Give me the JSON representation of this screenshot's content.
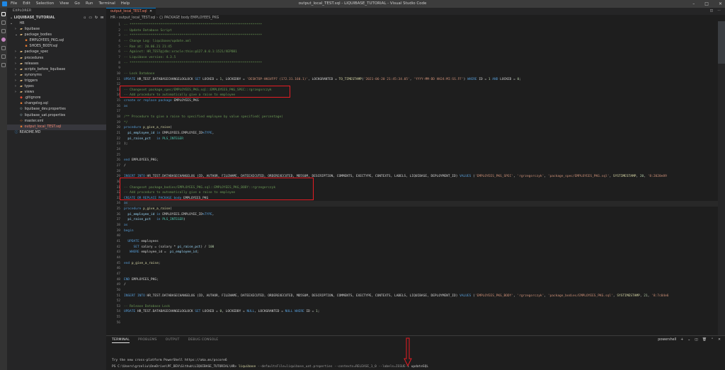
{
  "window": {
    "title": "output_local_TEST.sql - LIQUIBASE_TUTORIAL - Visual Studio Code",
    "menu": [
      "File",
      "Edit",
      "Selection",
      "View",
      "Go",
      "Run",
      "Terminal",
      "Help"
    ],
    "controls": [
      "–",
      "□",
      "✕"
    ]
  },
  "sidebar": {
    "header": "EXPLORER",
    "section": "LIQUIBASE_TUTORIAL",
    "tree": [
      {
        "label": "HR",
        "depth": 0,
        "chev": "⌄",
        "icon": "",
        "iconClass": ""
      },
      {
        "label": "liquibase",
        "depth": 1,
        "chev": "›",
        "icon": "▰",
        "iconClass": "ic-folder"
      },
      {
        "label": "package_bodies",
        "depth": 1,
        "chev": "⌄",
        "icon": "▰",
        "iconClass": "ic-folder"
      },
      {
        "label": "EMPLOYEES_PKG.sql",
        "depth": 2,
        "chev": "",
        "icon": "▪",
        "iconClass": "ic-sql"
      },
      {
        "label": "SHOES_BODY.sql",
        "depth": 2,
        "chev": "",
        "icon": "▪",
        "iconClass": "ic-sql"
      },
      {
        "label": "package_spec",
        "depth": 1,
        "chev": "›",
        "icon": "▰",
        "iconClass": "ic-folder"
      },
      {
        "label": "procedures",
        "depth": 1,
        "chev": "›",
        "icon": "▰",
        "iconClass": "ic-folder"
      },
      {
        "label": "releases",
        "depth": 1,
        "chev": "›",
        "icon": "▰",
        "iconClass": "ic-folder"
      },
      {
        "label": "scripts_before_liquibase",
        "depth": 1,
        "chev": "›",
        "icon": "▰",
        "iconClass": "ic-folder"
      },
      {
        "label": "synonyms",
        "depth": 1,
        "chev": "›",
        "icon": "▰",
        "iconClass": "ic-folder"
      },
      {
        "label": "triggers",
        "depth": 1,
        "chev": "›",
        "icon": "▰",
        "iconClass": "ic-folder"
      },
      {
        "label": "types",
        "depth": 1,
        "chev": "›",
        "icon": "▰",
        "iconClass": "ic-folder"
      },
      {
        "label": "views",
        "depth": 1,
        "chev": "›",
        "icon": "▰",
        "iconClass": "ic-folder"
      },
      {
        "label": ".gitignore",
        "depth": 1,
        "chev": "",
        "icon": "◆",
        "iconClass": "ic-git"
      },
      {
        "label": "changelog.sql",
        "depth": 1,
        "chev": "",
        "icon": "▪",
        "iconClass": "ic-sql"
      },
      {
        "label": "liquibase_dev.properties",
        "depth": 1,
        "chev": "",
        "icon": "⚙",
        "iconClass": "ic-prop"
      },
      {
        "label": "liquibase_uat.properties",
        "depth": 1,
        "chev": "",
        "icon": "⚙",
        "iconClass": "ic-prop"
      },
      {
        "label": "master.xml",
        "depth": 1,
        "chev": "",
        "icon": "‹›",
        "iconClass": "ic-xml"
      },
      {
        "label": "output_local_TEST.sql",
        "depth": 1,
        "chev": "",
        "icon": "▪",
        "iconClass": "ic-sql",
        "selected": true,
        "red": true
      },
      {
        "label": "README.MD",
        "depth": 0,
        "chev": "",
        "icon": "ⓘ",
        "iconClass": "ic-md"
      }
    ]
  },
  "editor": {
    "tab": "output_local_TEST.sql",
    "breadcrumb": "HR › output_local_TEST.sql › {} PACKAGE body EMPLOYEES_PKG",
    "current_line": 34,
    "lines": [
      {
        "n": 1,
        "segs": [
          [
            "cmt",
            "-- *********************************************************************"
          ]
        ]
      },
      {
        "n": 2,
        "segs": [
          [
            "cmt",
            "-- Update Database Script"
          ]
        ]
      },
      {
        "n": 3,
        "segs": [
          [
            "cmt",
            "-- *********************************************************************"
          ]
        ]
      },
      {
        "n": 4,
        "segs": [
          [
            "cmt",
            "-- Change Log: liquibase/update.xml"
          ]
        ]
      },
      {
        "n": 5,
        "segs": [
          [
            "cmt",
            "-- Ran at: 20.06.21 21:45"
          ]
        ]
      },
      {
        "n": 6,
        "segs": [
          [
            "cmt",
            "-- Against: HR_TEST@jdbc:oracle:thin:@127.0.0.1:1521/XEPDB1"
          ]
        ]
      },
      {
        "n": 7,
        "segs": [
          [
            "cmt",
            "-- Liquibase version: 4.3.5"
          ]
        ]
      },
      {
        "n": 8,
        "segs": [
          [
            "cmt",
            "-- *********************************************************************"
          ]
        ]
      },
      {
        "n": 9,
        "segs": []
      },
      {
        "n": 10,
        "segs": [
          [
            "cmt",
            "-- Lock Database"
          ]
        ]
      },
      {
        "n": 11,
        "segs": [
          [
            "kw",
            "UPDATE "
          ],
          [
            "",
            "HR_TEST.DATABASECHANGELOGLOCK "
          ],
          [
            "kw",
            "SET "
          ],
          [
            "",
            "LOCKED = "
          ],
          [
            "num",
            "1"
          ],
          [
            "",
            ", LOCKEDBY = "
          ],
          [
            "str",
            "'DESKTOP-HKGVFP7 (172.31.160.1)'"
          ],
          [
            "",
            ", LOCKGRANTED = "
          ],
          [
            "fn",
            "TO_TIMESTAMP"
          ],
          [
            "",
            "("
          ],
          [
            "str",
            "'2021-06-20 21:45:34.05'"
          ],
          [
            "",
            ", "
          ],
          [
            "str",
            "'YYYY-MM-DD HH24:MI:SS.FF'"
          ],
          [
            "",
            ") "
          ],
          [
            "kw",
            "WHERE "
          ],
          [
            "",
            "ID = "
          ],
          [
            "num",
            "1"
          ],
          [
            "kw",
            " AND "
          ],
          [
            "",
            "LOCKED = "
          ],
          [
            "num",
            "0"
          ],
          [
            "",
            ";"
          ]
        ]
      },
      {
        "n": 12,
        "segs": []
      },
      {
        "n": 13,
        "segs": [
          [
            "cmt",
            "-- Changeset package_spec/EMPLOYEES_PKG.sql::EMPLOYEES_PKG_SPEC::rgrzegorczyk"
          ]
        ]
      },
      {
        "n": 14,
        "segs": [
          [
            "cmt",
            "-- Add procedure to automatically give a raise to employee"
          ]
        ]
      },
      {
        "n": 15,
        "segs": [
          [
            "kw",
            "create or replace package "
          ],
          [
            "",
            "EMPLOYEES_PKG"
          ]
        ]
      },
      {
        "n": 16,
        "segs": [
          [
            "kw",
            "as"
          ]
        ]
      },
      {
        "n": 17,
        "segs": []
      },
      {
        "n": 18,
        "segs": [
          [
            "cmt",
            "/** Procedure to give a raise to specified employee by value specified( percentage)"
          ]
        ]
      },
      {
        "n": 19,
        "segs": [
          [
            "cmt",
            "*/"
          ]
        ]
      },
      {
        "n": 20,
        "segs": [
          [
            "kw",
            "procedure "
          ],
          [
            "fn",
            "p_give_a_raise"
          ],
          [
            "",
            "("
          ]
        ]
      },
      {
        "n": 21,
        "segs": [
          [
            "",
            "  "
          ],
          [
            "var",
            "pi_employee_id "
          ],
          [
            "kw",
            "in "
          ],
          [
            "",
            "EMPLOYEES.EMPLOYEE_ID"
          ],
          [
            "kw",
            "%TYPE"
          ],
          [
            "",
            ","
          ]
        ]
      },
      {
        "n": 22,
        "segs": [
          [
            "",
            "  "
          ],
          [
            "var",
            "pi_raise_pct   "
          ],
          [
            "kw",
            "in "
          ],
          [
            "typ",
            "PLS_INTEGER"
          ]
        ]
      },
      {
        "n": 23,
        "segs": [
          [
            "",
            ");"
          ]
        ]
      },
      {
        "n": 24,
        "segs": []
      },
      {
        "n": 25,
        "segs": []
      },
      {
        "n": 26,
        "segs": [
          [
            "kw",
            "end "
          ],
          [
            "",
            "EMPLOYEES_PKG;"
          ]
        ]
      },
      {
        "n": 27,
        "segs": [
          [
            "",
            "/"
          ]
        ]
      },
      {
        "n": 28,
        "segs": []
      },
      {
        "n": 29,
        "segs": [
          [
            "kw",
            "INSERT INTO "
          ],
          [
            "",
            "HR_TEST.DATABASECHANGELOG (ID, AUTHOR, FILENAME, DATEEXECUTED, ORDEREXECUTED, MD5SUM, DESCRIPTION, COMMENTS, EXECTYPE, CONTEXTS, LABELS, LIQUIBASE, DEPLOYMENT_ID) "
          ],
          [
            "kw",
            "VALUES "
          ],
          [
            "",
            "("
          ],
          [
            "str",
            "'EMPLOYEES_PKG_SPEC'"
          ],
          [
            "",
            ", "
          ],
          [
            "str",
            "'rgrzegorczyk'"
          ],
          [
            "",
            ", "
          ],
          [
            "str",
            "'package_spec/EMPLOYEES_PKG.sql'"
          ],
          [
            "",
            ", "
          ],
          [
            "fn",
            "SYSTIMESTAMP"
          ],
          [
            "",
            ", "
          ],
          [
            "num",
            "20"
          ],
          [
            "",
            ", "
          ],
          [
            "str",
            "'8:2020e89"
          ]
        ]
      },
      {
        "n": 30,
        "segs": []
      },
      {
        "n": 31,
        "segs": [
          [
            "cmt",
            "-- Changeset package_bodies/EMPLOYEES_PKG.sql::EMPLOYEES_PKG_BODY::rgrzegorczyk"
          ]
        ]
      },
      {
        "n": 32,
        "segs": [
          [
            "cmt",
            "-- Add procedure to automatically give a raise to employee"
          ]
        ]
      },
      {
        "n": 33,
        "segs": [
          [
            "kw",
            "CREATE OR REPLACE PACKAGE body "
          ],
          [
            "",
            "EMPLOYEES_PKG"
          ]
        ]
      },
      {
        "n": 34,
        "segs": [
          [
            "kw",
            "as"
          ]
        ]
      },
      {
        "n": 35,
        "segs": [
          [
            "kw",
            "procedure "
          ],
          [
            "fn",
            "p_give_a_raise"
          ],
          [
            "",
            "("
          ]
        ]
      },
      {
        "n": 36,
        "segs": [
          [
            "",
            "  "
          ],
          [
            "var",
            "pi_employee_id "
          ],
          [
            "kw",
            "in "
          ],
          [
            "",
            "EMPLOYEES.EMPLOYEE_ID"
          ],
          [
            "kw",
            "%TYPE"
          ],
          [
            "",
            ","
          ]
        ]
      },
      {
        "n": 37,
        "segs": [
          [
            "",
            "  "
          ],
          [
            "var",
            "pi_raise_pct   "
          ],
          [
            "kw",
            "in "
          ],
          [
            "typ",
            "PLS_INTEGER"
          ],
          [
            "",
            ")"
          ]
        ]
      },
      {
        "n": 38,
        "segs": [
          [
            "kw",
            "as"
          ]
        ]
      },
      {
        "n": 39,
        "segs": [
          [
            "kw",
            "begin"
          ]
        ]
      },
      {
        "n": 40,
        "segs": []
      },
      {
        "n": 41,
        "segs": [
          [
            "",
            "  "
          ],
          [
            "kw",
            "UPDATE "
          ],
          [
            "",
            "employees"
          ]
        ]
      },
      {
        "n": 42,
        "segs": [
          [
            "",
            "     "
          ],
          [
            "kw",
            "SET "
          ],
          [
            "",
            "salary = (salary * "
          ],
          [
            "var",
            "pi_raise_pct"
          ],
          [
            "",
            ") / "
          ],
          [
            "num",
            "100"
          ]
        ]
      },
      {
        "n": 43,
        "segs": [
          [
            "",
            "   "
          ],
          [
            "kw",
            "WHERE "
          ],
          [
            "",
            "employee_id =  "
          ],
          [
            "var",
            "pi_employee_id"
          ],
          [
            "",
            ";"
          ]
        ]
      },
      {
        "n": 44,
        "segs": []
      },
      {
        "n": 45,
        "segs": [
          [
            "kw",
            "end "
          ],
          [
            "fn",
            "p_give_a_raise"
          ],
          [
            "",
            ";"
          ]
        ]
      },
      {
        "n": 46,
        "segs": []
      },
      {
        "n": 47,
        "segs": []
      },
      {
        "n": 48,
        "segs": [
          [
            "kw",
            "END "
          ],
          [
            "",
            "EMPLOYEES_PKG;"
          ]
        ]
      },
      {
        "n": 49,
        "segs": [
          [
            "",
            "/"
          ]
        ]
      },
      {
        "n": 50,
        "segs": []
      },
      {
        "n": 51,
        "segs": [
          [
            "kw",
            "INSERT INTO "
          ],
          [
            "",
            "HR_TEST.DATABASECHANGELOG (ID, AUTHOR, FILENAME, DATEEXECUTED, ORDEREXECUTED, MD5SUM, DESCRIPTION, COMMENTS, EXECTYPE, CONTEXTS, LABELS, LIQUIBASE, DEPLOYMENT_ID) "
          ],
          [
            "kw",
            "VALUES "
          ],
          [
            "",
            "("
          ],
          [
            "str",
            "'EMPLOYEES_PKG_BODY'"
          ],
          [
            "",
            ", "
          ],
          [
            "str",
            "'rgrzegorczyk'"
          ],
          [
            "",
            ", "
          ],
          [
            "str",
            "'package_bodies/EMPLOYEES_PKG.sql'"
          ],
          [
            "",
            ", "
          ],
          [
            "fn",
            "SYSTIMESTAMP"
          ],
          [
            "",
            ", "
          ],
          [
            "num",
            "21"
          ],
          [
            "",
            ", "
          ],
          [
            "str",
            "'8:7c04e6"
          ]
        ]
      },
      {
        "n": 52,
        "segs": []
      },
      {
        "n": 53,
        "segs": [
          [
            "cmt",
            "-- Release Database Lock"
          ]
        ]
      },
      {
        "n": 54,
        "segs": [
          [
            "kw",
            "UPDATE "
          ],
          [
            "",
            "HR_TEST.DATABASECHANGELOGLOCK "
          ],
          [
            "kw",
            "SET "
          ],
          [
            "",
            "LOCKED = "
          ],
          [
            "num",
            "0"
          ],
          [
            "",
            ", LOCKEDBY = "
          ],
          [
            "kw",
            "NULL"
          ],
          [
            "",
            ", LOCKGRANTED = "
          ],
          [
            "kw",
            "NULL "
          ],
          [
            "kw",
            "WHERE "
          ],
          [
            "",
            "ID = "
          ],
          [
            "num",
            "1"
          ],
          [
            "",
            ";"
          ]
        ]
      },
      {
        "n": 55,
        "segs": []
      },
      {
        "n": 56,
        "segs": []
      }
    ]
  },
  "panel": {
    "tabs": [
      "TERMINAL",
      "PROBLEMS",
      "OUTPUT",
      "DEBUG CONSOLE"
    ],
    "active_tab": "TERMINAL",
    "shell": "powershell",
    "tools": [
      "+",
      "⌄",
      "◫",
      "🗑",
      "⌃",
      "✕"
    ],
    "line1": "Try the new cross-platform PowerShell https://aka.ms/pscore6",
    "prompt": "PS C:\\Users\\grzeliu\\OneDrive\\PF_DEV\\Github\\LIQUIBASE_TUTORIAL\\HR> ",
    "command": "liquibase",
    "args": " --defaultsFile=liquibase_uat.properties --contexts=RELEASE_1_0 --labels=ISSUE-1 ",
    "subcommand": "updateSQL"
  }
}
